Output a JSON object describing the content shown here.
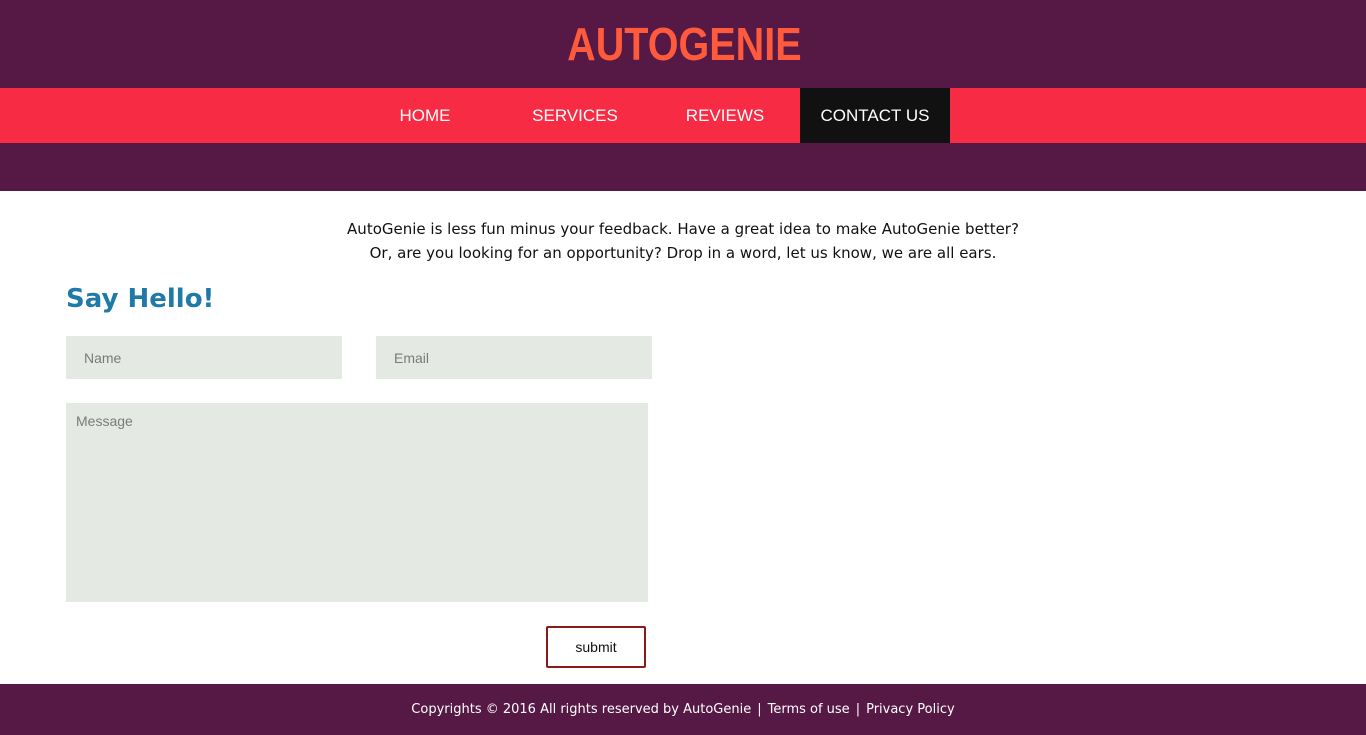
{
  "brand": {
    "logo_text": "AUTOGENIE"
  },
  "nav": {
    "items": [
      {
        "label": "HOME",
        "active": false
      },
      {
        "label": "SERVICES",
        "active": false
      },
      {
        "label": "REVIEWS",
        "active": false
      },
      {
        "label": "CONTACT US",
        "active": true
      }
    ]
  },
  "intro": {
    "line1": "AutoGenie is less fun minus your feedback. Have a great idea to make AutoGenie better?",
    "line2": "Or, are you looking for an opportunity? Drop in a word, let us know, we are all ears."
  },
  "form": {
    "title": "Say Hello!",
    "name_placeholder": "Name",
    "email_placeholder": "Email",
    "message_placeholder": "Message",
    "submit_label": "submit"
  },
  "footer": {
    "copyright": "Copyrights © 2016 All rights reserved by AutoGenie",
    "separator": "|",
    "terms_label": "Terms of use",
    "privacy_label": "Privacy Policy"
  },
  "colors": {
    "header_bg": "#561845",
    "nav_bg": "#f72b43",
    "nav_active_bg": "#111111",
    "logo": "#ff5a3c",
    "title": "#1f7aa8",
    "field_bg": "#e5e9e4",
    "submit_border": "#8b1a1a"
  }
}
